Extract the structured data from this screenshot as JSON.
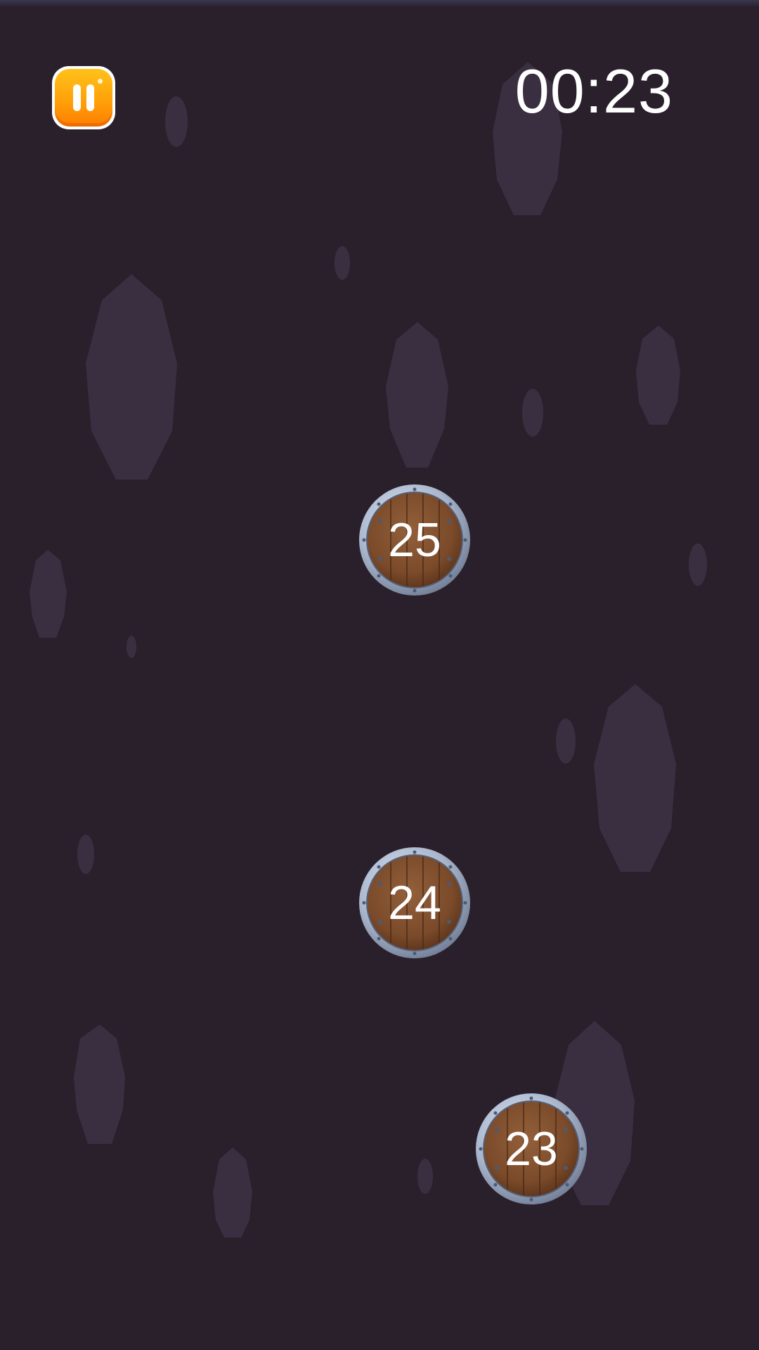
{
  "hud": {
    "timer": "00:23",
    "pause_icon": "pause-icon"
  },
  "tokens": [
    {
      "label": "25"
    },
    {
      "label": "24"
    },
    {
      "label": "23"
    }
  ],
  "colors": {
    "background": "#2a202c",
    "rock": "#3a2f40",
    "pause_button": "#ffa10a",
    "token_wood": "#7a4a2a",
    "token_rim": "#a9b6cc",
    "text": "#ffffff"
  }
}
